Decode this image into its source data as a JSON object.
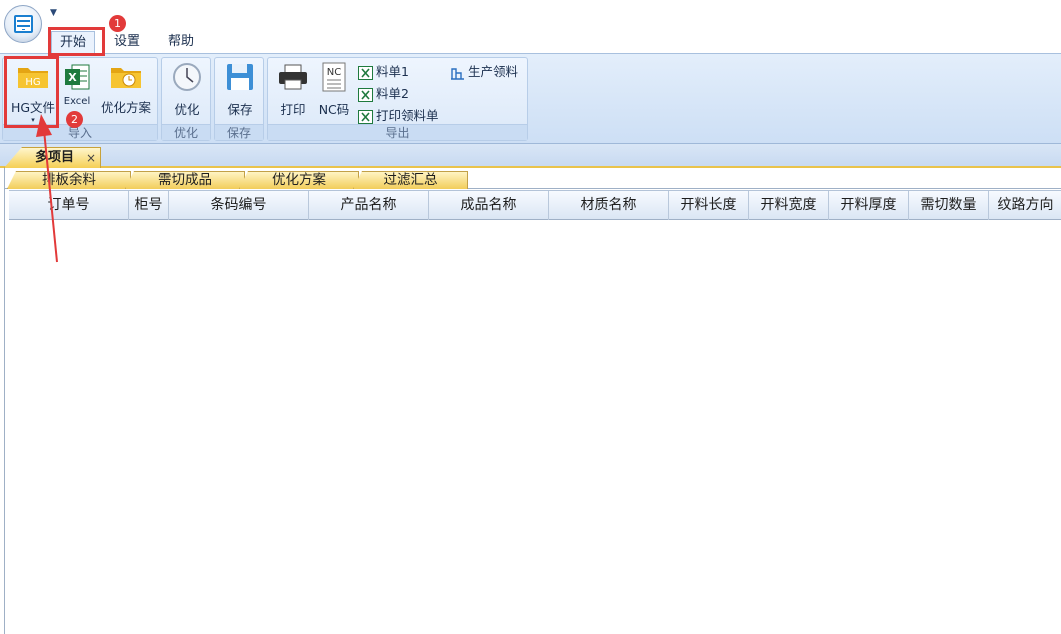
{
  "ribbon": {
    "tabs": [
      {
        "label": "开始",
        "active": true
      },
      {
        "label": "设置",
        "active": false
      },
      {
        "label": "帮助",
        "active": false
      }
    ],
    "groups": {
      "import": {
        "label": "导入",
        "buttons": {
          "hg": "HG文件",
          "excel": "Excel",
          "plan": "优化方案"
        },
        "hg_icon_text": "HG"
      },
      "optimize": {
        "label": "优化",
        "button": "优化"
      },
      "save": {
        "label": "保存",
        "button": "保存"
      },
      "export": {
        "label": "导出",
        "print": "打印",
        "nc": "NC码",
        "nc_icon_text": "NC",
        "list1": "料单1",
        "list2": "料单2",
        "print_requisition": "打印领料单",
        "production_requisition": "生产领料"
      }
    }
  },
  "document_tab": {
    "label": "多项目",
    "close": "×"
  },
  "subtabs": [
    "排板余料",
    "需切成品",
    "优化方案",
    "过滤汇总"
  ],
  "grid": {
    "columns": [
      "订单号",
      "柜号",
      "条码编号",
      "产品名称",
      "成品名称",
      "材质名称",
      "开料长度",
      "开料宽度",
      "开料厚度",
      "需切数量",
      "纹路方向"
    ],
    "rows": []
  },
  "annotations": {
    "badge1": "1",
    "badge2": "2",
    "color": "#e23a3a"
  },
  "colors": {
    "ribbon_bg": "#dbe8f8",
    "tab_gold": "#f2cd5a",
    "excel_green": "#1f7a3e",
    "folder_yellow": "#f2b820"
  }
}
